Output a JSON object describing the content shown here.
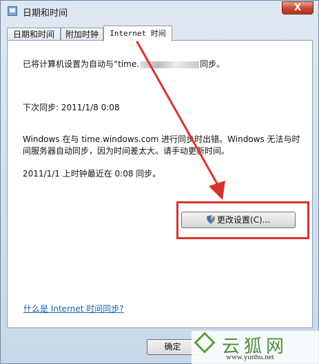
{
  "window": {
    "title": "日期和时间",
    "close_label": "X"
  },
  "tabs": [
    {
      "label": "日期和时间"
    },
    {
      "label": "附加时钟"
    },
    {
      "label": "Internet 时间"
    }
  ],
  "panel": {
    "sync_line_prefix": "已将计算机设置为自动与“time.",
    "sync_line_suffix": "同步。",
    "next_sync": "下次同步: 2011/1/8 0:08",
    "error_line1": "Windows 在与 time.windows.com 进行同步时出错。Windows 无法与时",
    "error_line2": "间服务器自动同步，因为时间差太大。请手动更新时间。",
    "last_sync": "2011/1/1 上时钟最近在 0:08 同步。",
    "change_settings_label": "更改设置(C)...",
    "help_link": "什么是 Internet 时间同步?"
  },
  "footer": {
    "ok_label": "确定"
  },
  "watermark": {
    "text": "云狐网",
    "url": "www.yunhu.net"
  },
  "colors": {
    "highlight": "#d8322b",
    "link": "#1560b3"
  }
}
